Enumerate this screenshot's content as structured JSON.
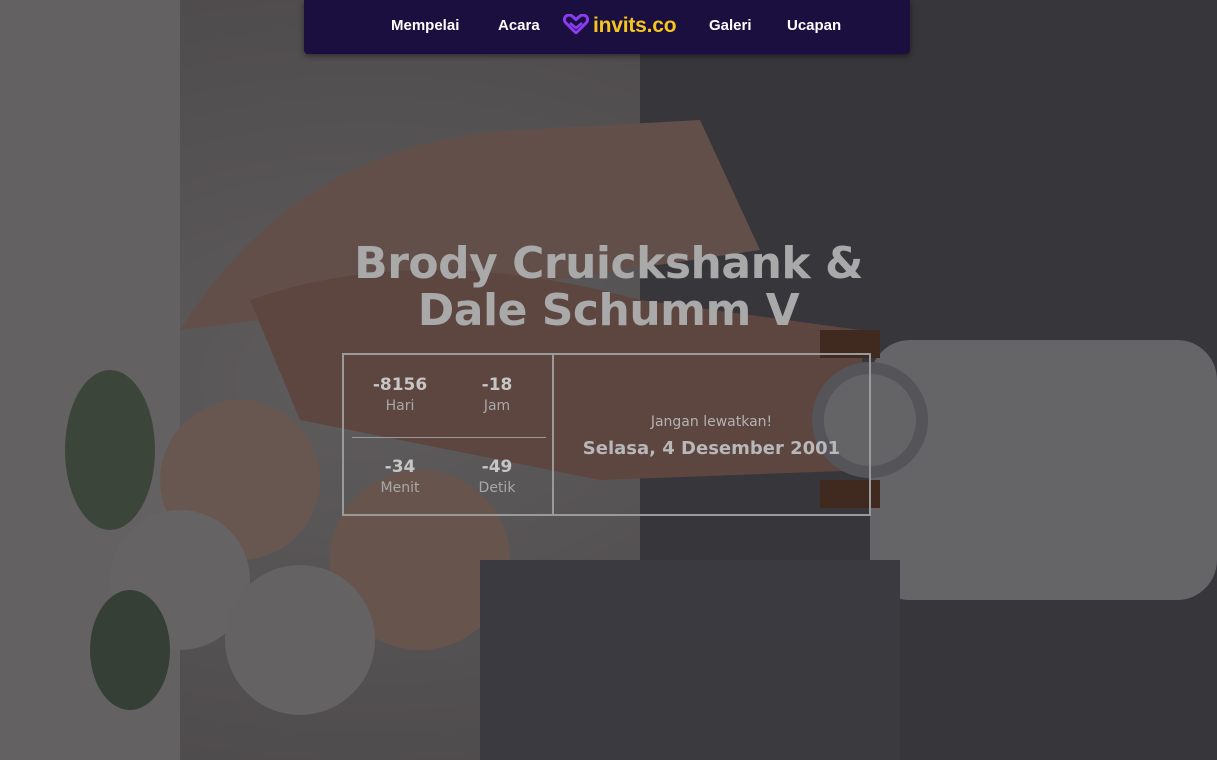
{
  "nav": {
    "items_left": [
      {
        "label": "Mempelai"
      },
      {
        "label": "Acara"
      }
    ],
    "brand": {
      "text": "invits.co",
      "icon": "heart-logo-icon",
      "color": "#f4c51c",
      "icon_color": "#8a3cf0"
    },
    "items_right": [
      {
        "label": "Galeri"
      },
      {
        "label": "Ucapan"
      }
    ],
    "background": "#1b0f3f"
  },
  "hero": {
    "names_line1": "Brody Cruickshank &",
    "names_line2": "Dale Schumm V",
    "background_image": "couple-hands-with-rings-and-bouquet"
  },
  "countdown": {
    "days": {
      "value": "-8156",
      "unit": "Hari"
    },
    "hours": {
      "value": "-18",
      "unit": "Jam"
    },
    "minutes": {
      "value": "-34",
      "unit": "Menit"
    },
    "seconds": {
      "value": "-49",
      "unit": "Detik"
    },
    "tagline": "Jangan lewatkan!",
    "date": "Selasa, 4 Desember 2001"
  }
}
